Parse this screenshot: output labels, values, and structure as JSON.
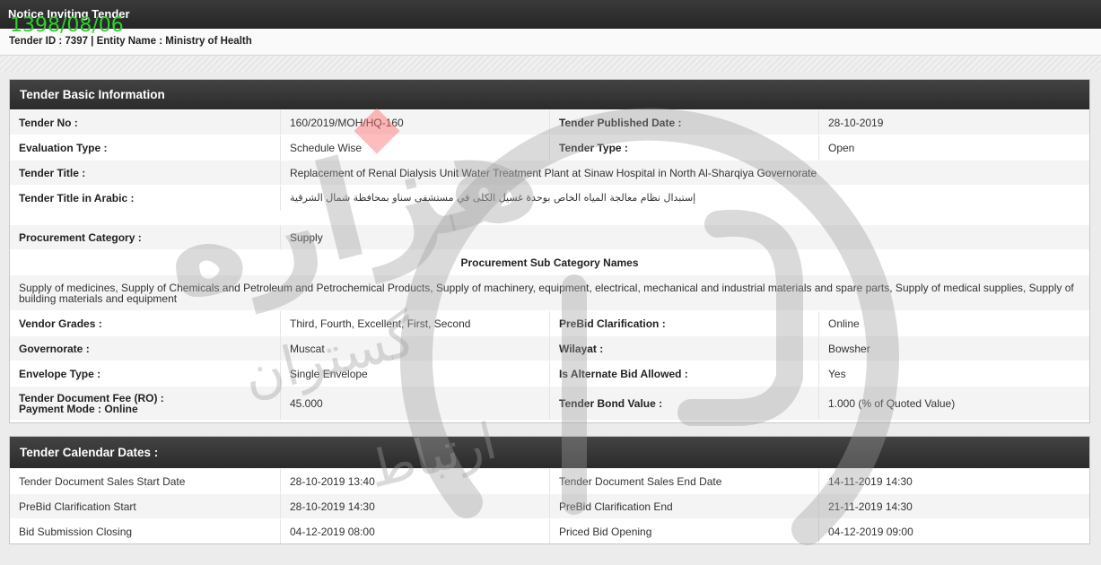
{
  "header": {
    "title": "Notice Inviting Tender",
    "meta": "Tender ID : 7397 | Entity Name : Ministry of Health",
    "stamp": "1398/08/06"
  },
  "basic": {
    "heading": "Tender Basic Information",
    "tender_no_label": "Tender No :",
    "tender_no": "160/2019/MOH/HQ-160",
    "published_label": "Tender Published Date :",
    "published": "28-10-2019",
    "eval_label": "Evaluation Type :",
    "eval": "Schedule Wise",
    "type_label": "Tender Type :",
    "type": "Open",
    "title_label": "Tender Title :",
    "title": "Replacement of Renal Dialysis Unit Water Treatment Plant at Sinaw Hospital in North Al-Sharqiya Governorate",
    "arabic_label": "Tender Title in Arabic :",
    "arabic": "إستبدال نظام معالجة المياه الخاص بوحدة غسيل الكلى في مستشفى سناو بمحافظة شمال الشرقية",
    "proc_cat_label": "Procurement Category :",
    "proc_cat": "Supply",
    "sub_cat_heading": "Procurement Sub Category Names",
    "sub_cat": "Supply of medicines, Supply of Chemicals and Petroleum and Petrochemical Products, Supply of machinery, equipment, electrical, mechanical and industrial materials and spare parts, Supply of medical supplies, Supply of building materials and equipment",
    "grades_label": "Vendor Grades :",
    "grades": "Third, Fourth, Excellent, First, Second",
    "prebid_label": "PreBid Clarification :",
    "prebid": "Online",
    "gov_label": "Governorate :",
    "gov": "Muscat",
    "wilayat_label": "Wilayat :",
    "wilayat": "Bowsher",
    "envelope_label": "Envelope Type :",
    "envelope": "Single Envelope",
    "alt_label": "Is Alternate Bid Allowed :",
    "alt": "Yes",
    "fee_label": "Tender Document Fee (RO) :",
    "payment_label": "Payment Mode :  Online",
    "fee": "45.000",
    "bond_label": "Tender Bond Value :",
    "bond": "1.000 (% of Quoted Value)"
  },
  "calendar": {
    "heading": "Tender Calendar Dates :",
    "rows": [
      {
        "l1": "Tender Document Sales Start Date",
        "v1": "28-10-2019 13:40",
        "l2": "Tender Document Sales End Date",
        "v2": "14-11-2019 14:30"
      },
      {
        "l1": "PreBid Clarification Start",
        "v1": "28-10-2019 14:30",
        "l2": "PreBid Clarification End",
        "v2": "21-11-2019 14:30"
      },
      {
        "l1": "Bid Submission Closing",
        "v1": "04-12-2019 08:00",
        "l2": "Priced Bid Opening",
        "v2": "04-12-2019 09:00"
      }
    ]
  },
  "watermark": {
    "color": "#9e9e9e",
    "accent": "#ff6b6b",
    "text_1": "هزاره",
    "text_2": "گستران",
    "text_3": "ارتباط"
  }
}
